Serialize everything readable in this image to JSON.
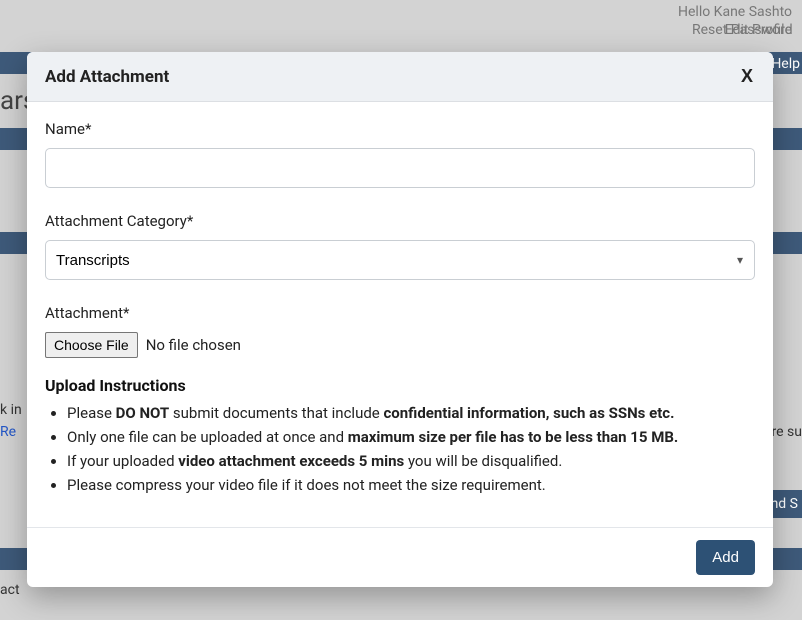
{
  "background": {
    "greeting": "Hello Kane Sashto",
    "edit_profile": "Edit Profile",
    "reset_password": "Reset Password",
    "help": "Help",
    "left_partial_1": "ars",
    "left_partial_2": "k in",
    "left_partial_3": "Re",
    "right_partial_1": "re su",
    "btn_fragment": "nd S",
    "contact_fragment": "act"
  },
  "modal": {
    "title": "Add Attachment",
    "close": "X",
    "name_label": "Name*",
    "name_value": "",
    "category_label": "Attachment Category*",
    "category_value": "Transcripts",
    "attachment_label": "Attachment*",
    "choose_file": "Choose File",
    "no_file": "No file chosen",
    "instructions_heading": "Upload Instructions",
    "instr1_a": "Please ",
    "instr1_b": "DO NOT",
    "instr1_c": " submit documents that include ",
    "instr1_d": "confidential information, such as SSNs etc.",
    "instr2_a": "Only one file can be uploaded at once and ",
    "instr2_b": "maximum size per file has to be less than 15 MB.",
    "instr3_a": "If your uploaded ",
    "instr3_b": "video attachment exceeds 5 mins",
    "instr3_c": " you will be disqualified.",
    "instr4": "Please compress your video file if it does not meet the size requirement.",
    "add_button": "Add"
  }
}
